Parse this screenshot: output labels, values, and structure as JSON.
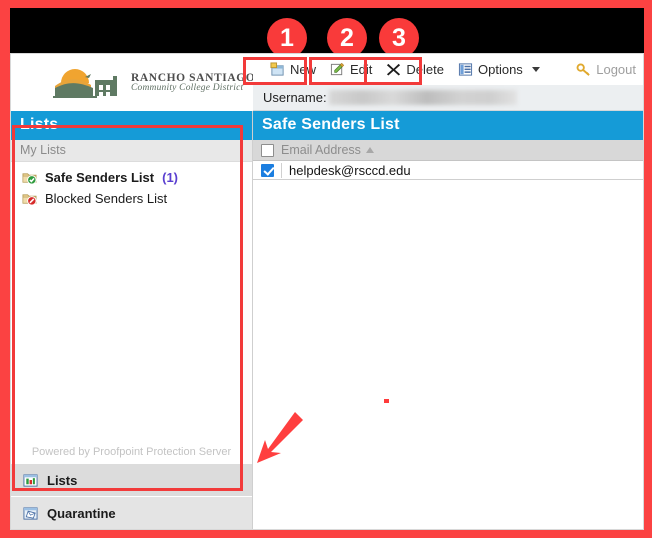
{
  "annotations": {
    "badges": [
      "1",
      "2",
      "3"
    ],
    "accent_color": "#f93a3a",
    "arrow_color": "#ff4040"
  },
  "brand": {
    "name_line1": "RANCHO SANTIAGO",
    "name_line2": "Community College District"
  },
  "toolbar": {
    "new_label": "New",
    "edit_label": "Edit",
    "delete_label": "Delete",
    "options_label": "Options",
    "logout_label": "Logout"
  },
  "userbar": {
    "username_label": "Username:",
    "username_value": ""
  },
  "sidebar": {
    "panel_title": "Lists",
    "subhead": "My Lists",
    "items": [
      {
        "label": "Safe Senders List",
        "count": "(1)",
        "active": true
      },
      {
        "label": "Blocked Senders List",
        "count": "",
        "active": false
      }
    ],
    "powered_by": "Powered by Proofpoint Protection Server",
    "nav": [
      {
        "label": "Lists"
      },
      {
        "label": "Quarantine"
      }
    ]
  },
  "main": {
    "panel_title": "Safe Senders List",
    "columns": [
      "Email Address"
    ],
    "sort_indicator": "ascending",
    "rows": [
      {
        "email": "helpdesk@rsccd.edu",
        "checked": true
      }
    ]
  },
  "colors": {
    "panel_header": "#159bd7",
    "checkbox_checked": "#1b7ee0",
    "count_text": "#5a3fd0"
  }
}
